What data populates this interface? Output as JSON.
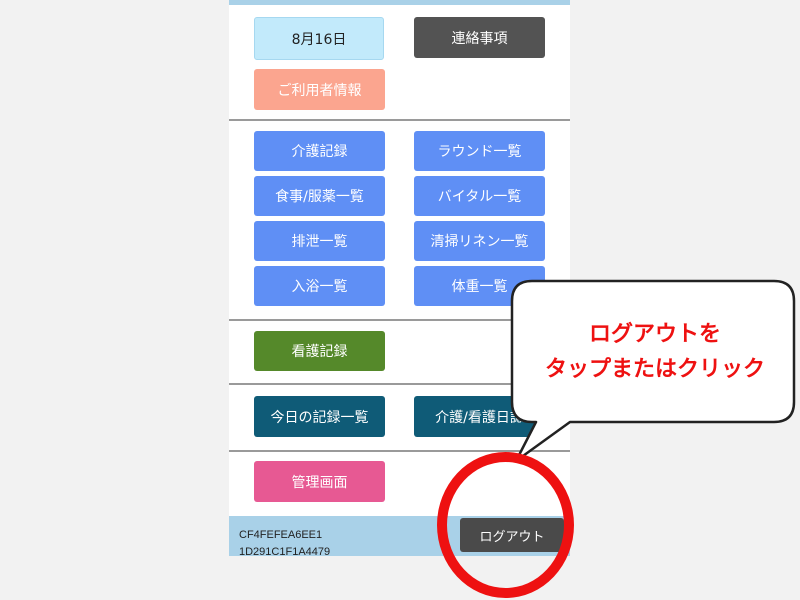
{
  "top": {
    "date_label": "8月16日",
    "notice_label": "連絡事項",
    "user_info_label": "ご利用者情報"
  },
  "records": [
    {
      "label": "介護記録"
    },
    {
      "label": "ラウンド一覧"
    },
    {
      "label": "食事/服薬一覧"
    },
    {
      "label": "バイタル一覧"
    },
    {
      "label": "排泄一覧"
    },
    {
      "label": "清掃リネン一覧"
    },
    {
      "label": "入浴一覧"
    },
    {
      "label": "体重一覧"
    }
  ],
  "nursing": {
    "label": "看護記録"
  },
  "summary": {
    "today_records_label": "今日の記録一覧",
    "journal_label": "介護/看護日誌"
  },
  "admin": {
    "label": "管理画面"
  },
  "footer": {
    "device_id": "CF4FEFEA6EE1",
    "device_id_line2": "1D291C1F1A4479",
    "logout_label": "ログアウト"
  },
  "callout": {
    "line1": "ログアウトを",
    "line2": "タップまたはクリック"
  },
  "colors": {
    "accent_red": "#ee1111",
    "footer_bg": "#a9d1e8",
    "record_blue": "#5f8ff5"
  }
}
